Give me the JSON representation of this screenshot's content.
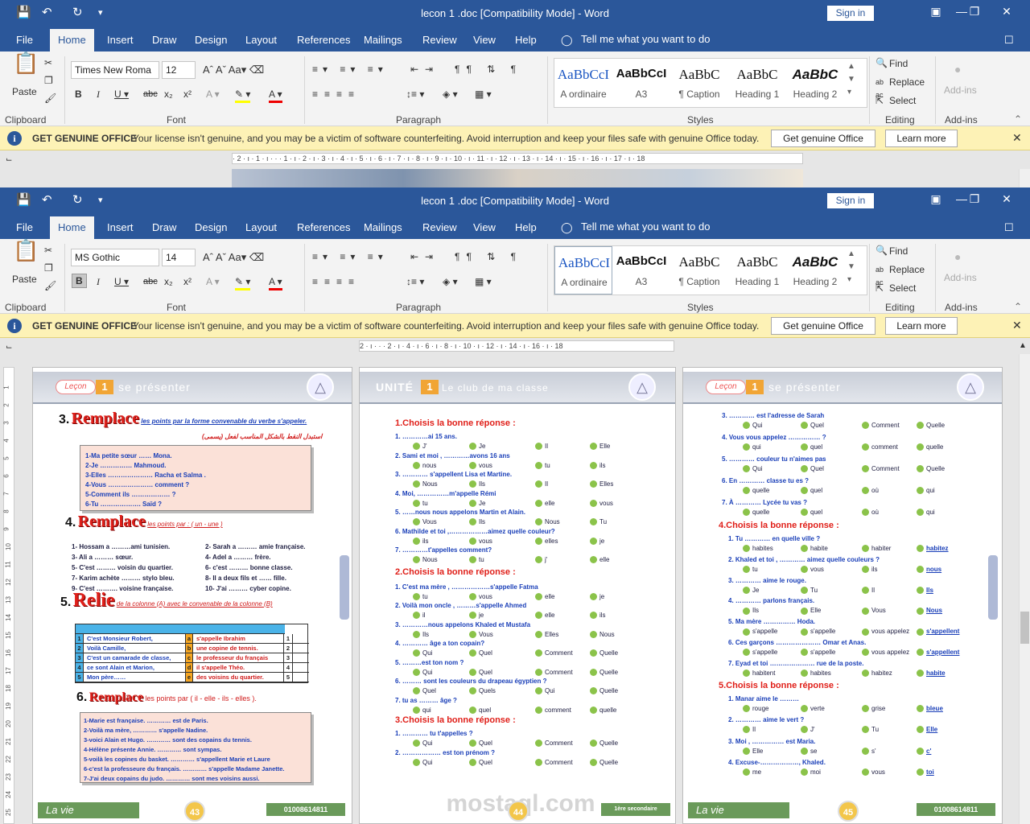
{
  "window_top": {
    "title": "lecon 1 .doc [Compatibility Mode]  -  Word",
    "signin": "Sign in",
    "tabs": [
      "File",
      "Home",
      "Insert",
      "Draw",
      "Design",
      "Layout",
      "References",
      "Mailings",
      "Review",
      "View",
      "Help"
    ],
    "tellme": "Tell me what you want to do",
    "font_name": "Times New Roma",
    "font_size": "12",
    "styles": [
      {
        "preview": "AaBbCcI",
        "name": "A ordinaire"
      },
      {
        "preview": "AaBbCcI",
        "name": "A3"
      },
      {
        "preview": "AaBbC",
        "name": "¶ Caption"
      },
      {
        "preview": "AaBbC",
        "name": "Heading 1"
      },
      {
        "preview": "AaBbC",
        "name": "Heading 2"
      }
    ],
    "ruler_text": "· 2 · ı · 1 · ı · · · 1 · ı · 2 · ı · 3 · ı · 4 · ı · 5 · ı · 6 · ı · 7 · ı · 8 · ı · 9 · ı · 10 · ı · 11 · ı · 12 · ı · 13 · ı · 14 · ı · 15 · ı · 16 · ı · 17 · ı · 18"
  },
  "window_bottom": {
    "title": "lecon 1 .doc [Compatibility Mode]  -  Word",
    "signin": "Sign in",
    "tabs": [
      "File",
      "Home",
      "Insert",
      "Draw",
      "Design",
      "Layout",
      "References",
      "Mailings",
      "Review",
      "View",
      "Help"
    ],
    "tellme": "Tell me what you want to do",
    "font_name": "MS Gothic",
    "font_size": "14",
    "styles": [
      {
        "preview": "AaBbCcI",
        "name": "A ordinaire"
      },
      {
        "preview": "AaBbCcI",
        "name": "A3"
      },
      {
        "preview": "AaBbC",
        "name": "¶ Caption"
      },
      {
        "preview": "AaBbC",
        "name": "Heading 1"
      },
      {
        "preview": "AaBbC",
        "name": "Heading 2"
      }
    ],
    "ruler_text": "2 · ı · · · 2 · ı · 4 · ı · 6 · ı · 8 · ı · 10 · ı · 12 · ı · 14 · ı · 16 · ı · 18"
  },
  "ribbon": {
    "paste": "Paste",
    "groups": [
      "Clipboard",
      "Font",
      "Paragraph",
      "Styles",
      "Editing",
      "Add-ins"
    ],
    "find": "Find",
    "replace": "Replace",
    "select": "Select",
    "addins": "Add-ins"
  },
  "msgbar": {
    "title": "GET GENUINE OFFICE",
    "text": "Your license isn't genuine, and you may be a victim of software counterfeiting. Avoid interruption and keep your files safe with genuine Office today.",
    "btn1": "Get genuine Office",
    "btn2": "Learn more"
  },
  "page1": {
    "header_tag": "Leçon",
    "header_num": "1",
    "header_title": "se présenter",
    "s3_title": "Remplace",
    "s3_instr": "les points par la forme convenable du verbe s'appeler.",
    "s3_ar": "استبدل النقط بالشكل المناسب لفعل (يسمى)",
    "s3_lines": [
      "1-Ma petite sœur …… Mona.",
      "2-Je …………… Mahmoud.",
      "3-Elles ………………… Racha et Salma .",
      "4-Vous ………………… comment ?",
      "5-Comment ils ……………… ?",
      "6-Tu ………………. Saïd ?"
    ],
    "s4_title": "Remplace",
    "s4_instr": "les points par : (   un   -   une  )",
    "s4_left": [
      "1- Hossam a ………ami tunisien.",
      "3- Ali a ……… sœur.",
      "5- C'est ……… voisin du quartier.",
      "7- Karim achète ……… stylo bleu.",
      "9- C'est ………. voisine française."
    ],
    "s4_right": [
      "2- Sarah a ……… amie française.",
      "4- Adel a ……… frère.",
      "6- c'est ……… bonne classe.",
      "8- Il a deux fils et …… fille.",
      "10- J'ai ……… cyber copine."
    ],
    "s5_title": "Relie",
    "s5_instr": "de la colonne (A)  avec le convenable de la colonne (B)",
    "s5_a": [
      "C'est Monsieur Robert,",
      "Voilà Camille,",
      "C'est un camarade de classe,",
      "ce sont Alain et Marion,",
      "Mon père……"
    ],
    "s5_b": [
      "s'appelle Ibrahim",
      "une copine de tennis.",
      "le professeur du français",
      "il s'appelle Théo.",
      "des voisins du quartier."
    ],
    "s5_letters": [
      "a",
      "b",
      "c",
      "d",
      "e"
    ],
    "s6_title": "Remplace",
    "s6_instr": "les points par ( il  -  elle   -  ils   - elles ).",
    "s6_lines": [
      "1-Marie est française. ………… est de Paris.",
      "2-Voilà ma mère, ………… s'appelle Nadine.",
      "3-voici Alain et Hugo. ………… sont des copains du tennis.",
      "4-Hélène présente Annie. ………… sont sympas.",
      "5-voilà les copines du basket. ………… s'appellent Marie et Laure",
      "6-c'est la professeure du français. ………… s'appelle Madame Janette.",
      "7-J'ai deux copains du judo. ………… sont mes voisins aussi."
    ],
    "foot_left": "La vie",
    "foot_num": "43",
    "foot_phone": "01008614811"
  },
  "page2": {
    "header_tag": "UNITÉ",
    "header_num": "1",
    "header_title": "Le club de ma classe",
    "sec1": "1.Choisis la bonne réponse :",
    "q1": [
      {
        "q": "1.  …………ai 15 ans.",
        "o": [
          "J'",
          "Je",
          "Il",
          "Elle"
        ]
      },
      {
        "q": "2.  Sami et moi , …………avons 16 ans",
        "o": [
          "nous",
          "vous",
          "tu",
          "ils"
        ]
      },
      {
        "q": "3.  ………… s'appellent Lisa et Martine.",
        "o": [
          "Nous",
          "Ils",
          "Il",
          "Elles"
        ]
      },
      {
        "q": "4.  Moi, ……………m'appelle Rémi",
        "o": [
          "tu",
          "Je",
          "elle",
          "vous"
        ]
      },
      {
        "q": "5.  ……nous nous appelons Martin et Alain.",
        "o": [
          "Vous",
          "Ils",
          "Nous",
          "Tu"
        ]
      },
      {
        "q": "6.  Mathilde et toi ,………………aimez quelle couleur?",
        "o": [
          "ils",
          "vous",
          "elles",
          "je"
        ]
      },
      {
        "q": "7.  …………t'appelles comment?",
        "o": [
          "Nous",
          "tu",
          "j'",
          "elle"
        ]
      }
    ],
    "sec2": "2.Choisis la bonne réponse :",
    "q2": [
      {
        "q": "1.  C'est ma mère , ………………s'appelle Fatma",
        "o": [
          "tu",
          "vous",
          "elle",
          "je"
        ]
      },
      {
        "q": "2.  Voilà mon oncle , ………s'appelle Ahmed",
        "o": [
          "il",
          "je",
          "elle",
          "ils"
        ]
      },
      {
        "q": "3.  …………nous appelons Khaled et Mustafa",
        "o": [
          "Ils",
          "Vous",
          "Elles",
          "Nous"
        ]
      },
      {
        "q": "4.  ………… âge a ton copain?",
        "o": [
          "Qui",
          "Quel",
          "Comment",
          "Quelle"
        ]
      },
      {
        "q": "5.  ………est ton nom ?",
        "o": [
          "Qui",
          "Quel",
          "Comment",
          "Quelle"
        ]
      },
      {
        "q": "6.  ……… sont les couleurs du drapeau égyptien ?",
        "o": [
          "Quel",
          "Quels",
          "Qui",
          "Quelle"
        ]
      },
      {
        "q": "7.  tu as ……… âge ?",
        "o": [
          "qui",
          "quel",
          "comment",
          "quelle"
        ]
      }
    ],
    "sec3": "3.Choisis la bonne réponse :",
    "q3": [
      {
        "q": "1.  ………… tu t'appelles ?",
        "o": [
          "Qui",
          "Quel",
          "Comment",
          "Quelle"
        ]
      },
      {
        "q": "2.  ……………… est ton prénom ?",
        "o": [
          "Qui",
          "Quel",
          "Comment",
          "Quelle"
        ]
      }
    ],
    "foot_num": "44",
    "foot_right": "1ère secondaire",
    "watermark": "mostaql.com"
  },
  "page3": {
    "header_tag": "Leçon",
    "header_num": "1",
    "header_title": "se présenter",
    "q0": [
      {
        "q": "3.  ………… est l'adresse de Sarah",
        "o": [
          "Qui",
          "Quel",
          "Comment",
          "Quelle"
        ]
      },
      {
        "q": "4.  Vous vous appelez …………… ?",
        "o": [
          "qui",
          "quel",
          "comment",
          "quelle"
        ]
      },
      {
        "q": "5.  ………… couleur tu n'aimes pas",
        "o": [
          "Qui",
          "Quel",
          "Comment",
          "Quelle"
        ]
      },
      {
        "q": "6.  En ………… classe tu es ?",
        "o": [
          "quelle",
          "quel",
          "où",
          "qui"
        ]
      },
      {
        "q": "7.  À ………… Lycée tu vas ?",
        "o": [
          "quelle",
          "quel",
          "où",
          "qui"
        ]
      }
    ],
    "sec4": "4.Choisis la bonne réponse :",
    "q4": [
      {
        "q": "1.  Tu ………… en quelle ville ?",
        "o": [
          "habites",
          "habite",
          "habiter",
          "habitez"
        ]
      },
      {
        "q": "2.  Khaled et toi , ………… aimez quelle couleurs ?",
        "o": [
          "tu",
          "vous",
          "ils",
          "nous"
        ]
      },
      {
        "q": "3.  ………… aime le rouge.",
        "o": [
          "Je",
          "Tu",
          "Il",
          "Ils"
        ]
      },
      {
        "q": "4.  ………… parlons français.",
        "o": [
          "Ils",
          "Elle",
          "Vous",
          "Nous"
        ]
      },
      {
        "q": "5. Ma mère …………… Hoda.",
        "o": [
          "s'appelle",
          "s'appelle",
          "vous appelez",
          "s'appellent"
        ]
      },
      {
        "q": "6. Ces garçons ………………… Omar et Anas.",
        "o": [
          "s'appelle",
          "s'appelle",
          "vous appelez",
          "s'appellent"
        ]
      },
      {
        "q": "7. Eyad et toi ………………… rue de la poste.",
        "o": [
          "habitent",
          "habites",
          "habitez",
          "habite"
        ]
      }
    ],
    "sec5": "5.Choisis la bonne réponse :",
    "q5": [
      {
        "q": "1.  Manar aime le ………",
        "o": [
          "rouge",
          "verte",
          "grise",
          "bleue"
        ]
      },
      {
        "q": "2.  ………… aime le vert ?",
        "o": [
          "Il",
          "J'",
          "Tu",
          "Elle"
        ]
      },
      {
        "q": "3. Moi , …………… est Maria.",
        "o": [
          "Elle",
          "se",
          "s'",
          "c'"
        ]
      },
      {
        "q": "4. Excuse-………………, Khaled.",
        "o": [
          "me",
          "moi",
          "vous",
          "toi"
        ]
      }
    ],
    "foot_left": "La vie",
    "foot_num": "45",
    "foot_phone": "01008614811"
  },
  "vruler_numbers": [
    "1",
    "2",
    "3",
    "4",
    "5",
    "6",
    "7",
    "8",
    "9",
    "10",
    "11",
    "12",
    "13",
    "14",
    "15",
    "16",
    "17",
    "18",
    "19",
    "20",
    "21",
    "22",
    "23",
    "24",
    "25"
  ]
}
